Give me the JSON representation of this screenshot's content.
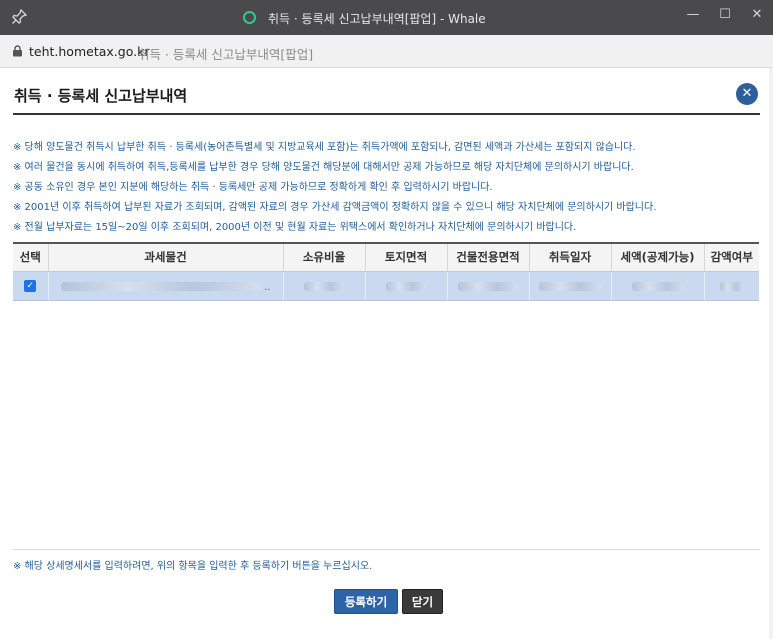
{
  "window": {
    "title": "취득 · 등록세 신고납부내역[팝업] - Whale",
    "minimize": "—",
    "maximize": "☐",
    "close": "✕"
  },
  "address": {
    "url": "teht.hometax.go.kr",
    "page_title": "취득 · 등록세 신고납부내역[팝업]"
  },
  "header": {
    "title": "취득 · 등록세 신고납부내역",
    "close_symbol": "✕"
  },
  "notices": [
    "※ 당해 양도물건 취득시 납부한 취득 · 등록세(농어촌특별세 및 지방교육세 포함)는 취득가액에 포함되나, 감면된 세액과 가산세는 포함되지 않습니다.",
    "※ 여러 물건을 동시에 취득하여 취득,등록세를 납부한 경우 당해 양도물건 해당분에 대해서만 공제 가능하므로 해당 자치단체에 문의하시기 바랍니다.",
    "※ 공동 소유인 경우 본인 지분에 해당하는 취득 · 등록세만 공제 가능하므로 정확하게 확인 후 입력하시기 바랍니다.",
    "※ 2001년 이후 취득하여 납부된 자료가 조회되며, 감액된 자료의 경우 가산세 감액금액이 정확하지 않을 수 있으니 해당 자치단체에 문의하시기 바랍니다.",
    "※ 전월 납부자료는 15일~20일 이후 조회되며, 2000년 이전 및 현월 자료는 위택스에서 확인하거나 자치단체에 문의하시기 바랍니다."
  ],
  "table": {
    "headers": [
      "선택",
      "과세물건",
      "소유비율",
      "토지면적",
      "건물전용면적",
      "취득일자",
      "세액(공제가능)",
      "감액여부"
    ],
    "row_checked": true,
    "row_check_mark": "✓",
    "row_ellipsis": ".."
  },
  "footnote": "※ 해당 상세명세서를 입력하려면, 위의 항목을 입력한 후 등록하기 버튼을 누르십시오.",
  "buttons": {
    "register": "등록하기",
    "close": "닫기"
  },
  "colors": {
    "title_bar": "#4a4a4c",
    "notice_text": "#1f5c99",
    "row_selected": "#c9daf0",
    "register_button": "#2e63a7",
    "close_button": "#3a3a3a"
  }
}
